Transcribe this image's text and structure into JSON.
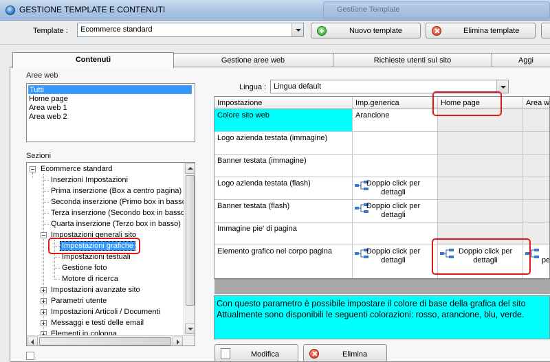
{
  "window": {
    "title": "GESTIONE TEMPLATE E CONTENUTI",
    "background_window_text": "Gestione Template"
  },
  "toolbar": {
    "template_label": "Template :",
    "template_value": "Ecommerce standard",
    "new_template": "Nuovo template",
    "delete_template": "Elimina template"
  },
  "tabs": [
    {
      "label": "Contenuti",
      "active": true
    },
    {
      "label": "Gestione aree web",
      "active": false
    },
    {
      "label": "Richieste utenti sul sito",
      "active": false
    },
    {
      "label": "Aggi",
      "active": false
    }
  ],
  "aree_web": {
    "label": "Aree web",
    "items": [
      "Tutti",
      "Home page",
      "Area web 1",
      "Area web 2"
    ],
    "selected": "Tutti"
  },
  "sezioni": {
    "label": "Sezioni",
    "tree": [
      {
        "label": "Ecommerce standard",
        "level": 0,
        "toggle": "minus"
      },
      {
        "label": "Inserzioni Impostazioni",
        "level": 1
      },
      {
        "label": "Prima inserzione (Box a centro pagina)",
        "level": 1
      },
      {
        "label": "Seconda inserzione (Primo box in basso)",
        "level": 1
      },
      {
        "label": "Terza inserzione (Secondo box in basso)",
        "level": 1
      },
      {
        "label": "Quarta inserzione (Terzo box in basso)",
        "level": 1
      },
      {
        "label": "Impostazioni generali sito",
        "level": 1,
        "toggle": "minus"
      },
      {
        "label": "Impostazioni grafiche",
        "level": 2,
        "selected": true
      },
      {
        "label": "Impostazioni testuali",
        "level": 2
      },
      {
        "label": "Gestione foto",
        "level": 2
      },
      {
        "label": "Motore di ricerca",
        "level": 2
      },
      {
        "label": "Impostazioni avanzate sito",
        "level": 1,
        "toggle": "plus"
      },
      {
        "label": "Parametri utente",
        "level": 1,
        "toggle": "plus"
      },
      {
        "label": "Impostazioni Articoli / Documenti",
        "level": 1,
        "toggle": "plus"
      },
      {
        "label": "Messaggi e testi delle email",
        "level": 1,
        "toggle": "plus"
      },
      {
        "label": "Elementi in colonna",
        "level": 1,
        "toggle": "plus"
      }
    ]
  },
  "lingua": {
    "label": "Lingua :",
    "value": "Lingua default"
  },
  "grid": {
    "columns": [
      "Impostazione",
      "Imp.generica",
      "Home page",
      "Area we"
    ],
    "rows": [
      {
        "name": "Colore sito web",
        "generic": "Arancione",
        "home": "",
        "area": ""
      },
      {
        "name": "Logo azienda testata (immagine)",
        "generic": "",
        "home": "",
        "area": ""
      },
      {
        "name": "Banner testata (immagine)",
        "generic": "",
        "home": "",
        "area": ""
      },
      {
        "name": "Logo azienda testata (flash)",
        "generic": "Doppio click per dettagli",
        "home": "",
        "area": ""
      },
      {
        "name": "Banner testata (flash)",
        "generic": "Doppio click per dettagli",
        "home": "",
        "area": ""
      },
      {
        "name": "Immagine pie' di pagina",
        "generic": "",
        "home": "",
        "area": ""
      },
      {
        "name": "Elemento grafico nel corpo pagina",
        "generic": "Doppio click per dettagli",
        "home": "Doppio click per dettagli",
        "area": "per"
      }
    ]
  },
  "info": {
    "line1": "Con questo parametro è possibile impostare il colore di base della grafica del sito",
    "line2": "Attualmente sono disponibili le seguenti colorazioni: rosso, arancione, blu, verde."
  },
  "actions": {
    "modify": "Modifica",
    "delete": "Elimina"
  },
  "colors": {
    "highlight_cyan": "#00ffff",
    "selection_blue": "#3399ff",
    "annotation_red": "#e01818"
  }
}
